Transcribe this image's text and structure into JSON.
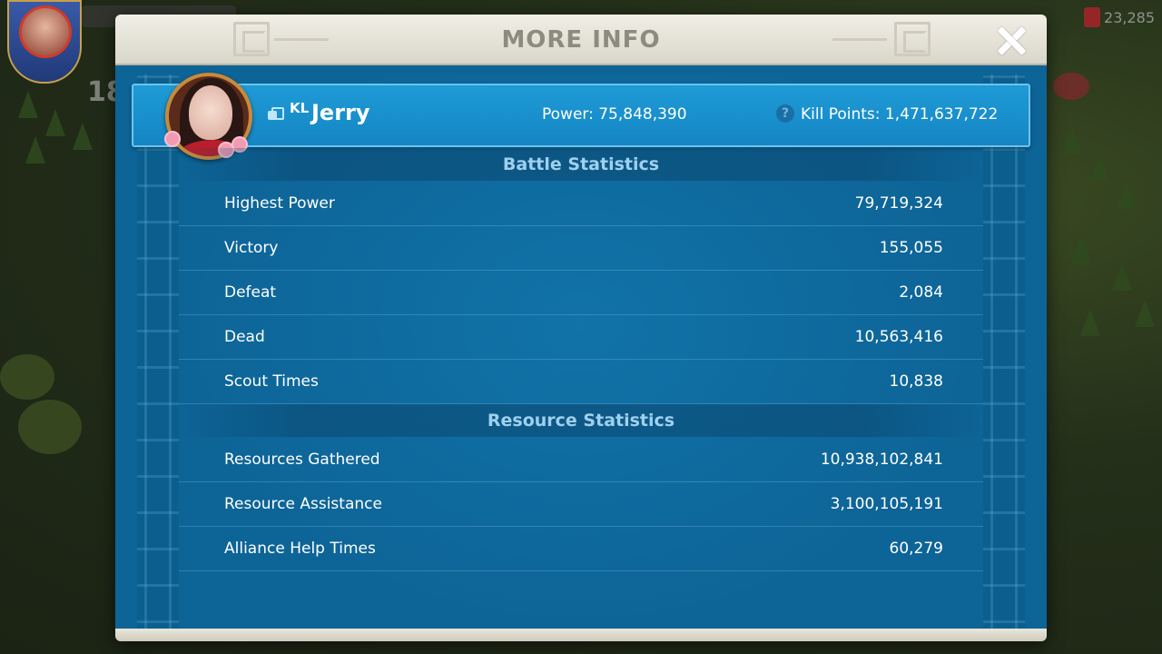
{
  "hud": {
    "level": "18",
    "gems": "23,285"
  },
  "modal": {
    "title": "MORE INFO"
  },
  "player": {
    "alliance_tag": "KL",
    "name": "Jerry",
    "power": "Power: 75,848,390",
    "kill_points": "Kill Points: 1,471,637,722"
  },
  "battle": {
    "title": "Battle Statistics",
    "rows": [
      {
        "label": "Highest Power",
        "value": "79,719,324"
      },
      {
        "label": "Victory",
        "value": "155,055"
      },
      {
        "label": "Defeat",
        "value": "2,084"
      },
      {
        "label": "Dead",
        "value": "10,563,416"
      },
      {
        "label": "Scout Times",
        "value": "10,838"
      }
    ]
  },
  "resource": {
    "title": "Resource Statistics",
    "rows": [
      {
        "label": "Resources Gathered",
        "value": "10,938,102,841"
      },
      {
        "label": "Resource Assistance",
        "value": "3,100,105,191"
      },
      {
        "label": "Alliance Help Times",
        "value": "60,279"
      }
    ]
  },
  "colors": {
    "panel": "#0d6496",
    "card": "#1e9bd6",
    "section_text": "#9fd0ef",
    "header": "#e9e6da"
  },
  "icons": {
    "close": "close-icon",
    "copy": "copy-icon",
    "help": "help-icon",
    "gem": "gem-icon"
  }
}
